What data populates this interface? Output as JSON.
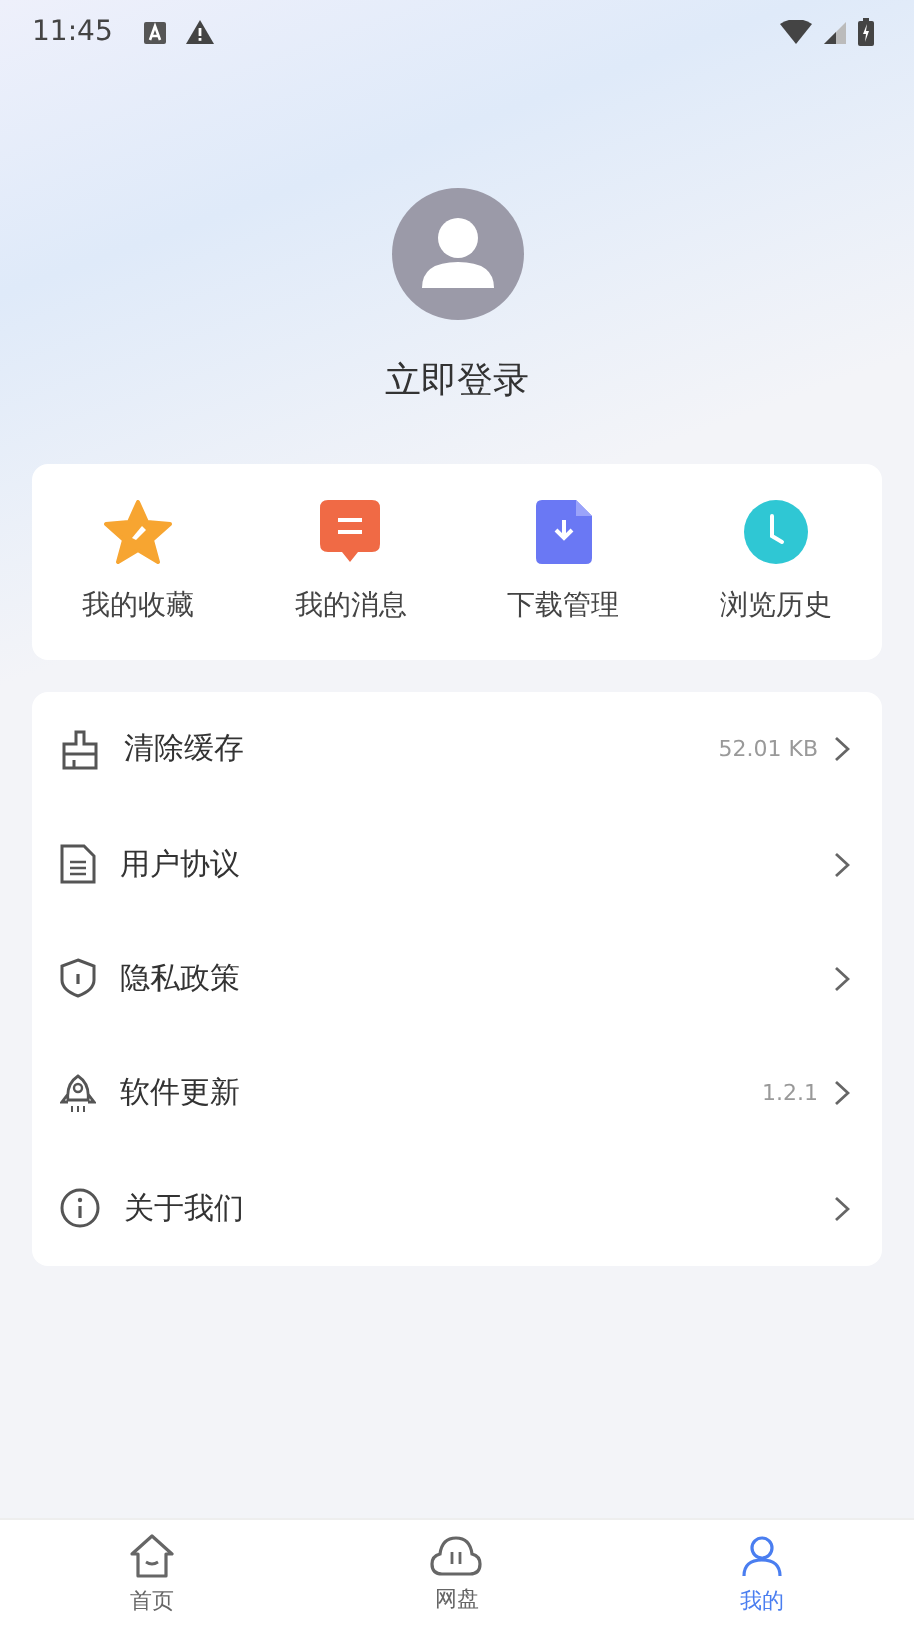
{
  "status_bar": {
    "time": "11:45"
  },
  "profile": {
    "login_label": "立即登录"
  },
  "shortcuts": [
    {
      "kind": "favorites",
      "label": "我的收藏"
    },
    {
      "kind": "messages",
      "label": "我的消息"
    },
    {
      "kind": "downloads",
      "label": "下载管理"
    },
    {
      "kind": "history",
      "label": "浏览历史"
    }
  ],
  "settings": [
    {
      "kind": "cache",
      "label": "清除缓存",
      "value": "52.01 KB"
    },
    {
      "kind": "agreement",
      "label": "用户协议"
    },
    {
      "kind": "privacy",
      "label": "隐私政策"
    },
    {
      "kind": "update",
      "label": "软件更新",
      "value": "1.2.1"
    },
    {
      "kind": "about",
      "label": "关于我们"
    }
  ],
  "tabs": [
    {
      "kind": "home",
      "label": "首页",
      "selected": false
    },
    {
      "kind": "cloud",
      "label": "网盘",
      "selected": false
    },
    {
      "kind": "me",
      "label": "我的",
      "selected": true
    }
  ]
}
